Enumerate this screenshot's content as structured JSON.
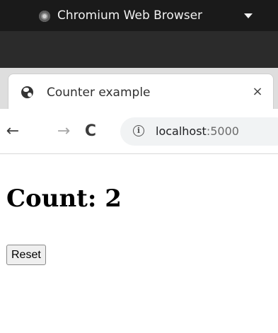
{
  "os_topbar": {
    "app_name": "Chromium Web Browser",
    "app_icon": "chromium-icon",
    "menu_icon": "caret-down-icon"
  },
  "tab": {
    "title": "Counter example",
    "favicon": "globe-icon",
    "close_glyph": "×"
  },
  "toolbar": {
    "back_glyph": "←",
    "forward_glyph": "→",
    "reload_glyph": "C",
    "info_glyph": "i",
    "url_host": "localhost",
    "url_port": ":5000"
  },
  "page": {
    "count_text": "Count: 2",
    "reset_label": "Reset"
  }
}
